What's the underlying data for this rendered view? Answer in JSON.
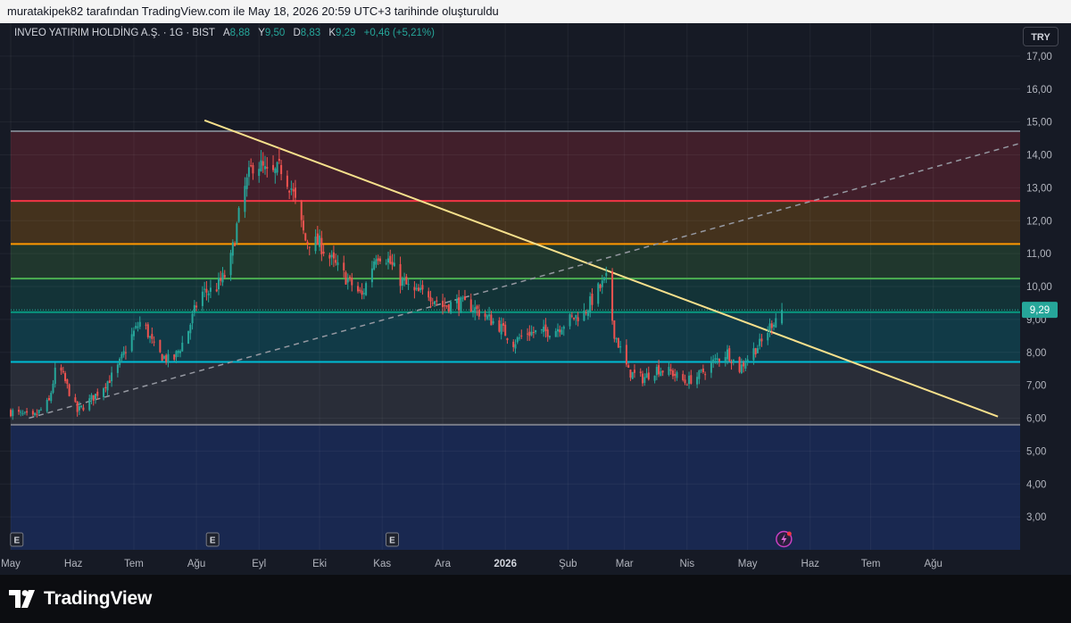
{
  "header": {
    "attribution": "muratakipek82 tarafından TradingView.com ile May 18, 2026 20:59 UTC+3 tarihinde oluşturuldu"
  },
  "legend": {
    "symbol": "INVEO YATIRIM HOLDİNG A.Ş. · 1G · BIST",
    "open_label": "A",
    "open_value": "8,88",
    "high_label": "Y",
    "high_value": "9,50",
    "low_label": "D",
    "low_value": "8,83",
    "close_label": "K",
    "close_value": "9,29",
    "change": "+0,46 (+5,21%)"
  },
  "currency_button": "TRY",
  "footer": {
    "brand": "TradingView"
  },
  "colors": {
    "up": "#26a69a",
    "down": "#ef5350",
    "trendline": "#f7e08c",
    "dashed_trendline": "#9598a1",
    "price_line": "#26a69a"
  },
  "chart_data": {
    "type": "candlestick",
    "title": "INVEO YATIRIM HOLDİNG A.Ş. · 1G · BIST",
    "x_range": [
      "2025-05-01",
      "2026-09-13"
    ],
    "ylim": [
      2.0,
      18.0
    ],
    "y_ticks": [
      "3,00",
      "4,00",
      "5,00",
      "6,00",
      "7,00",
      "8,00",
      "9,00",
      "10,00",
      "11,00",
      "12,00",
      "13,00",
      "14,00",
      "15,00",
      "16,00",
      "17,00"
    ],
    "x_ticks": [
      {
        "date": "2025-05-01",
        "label": "May",
        "bold": false
      },
      {
        "date": "2025-06-01",
        "label": "Haz",
        "bold": false
      },
      {
        "date": "2025-07-01",
        "label": "Tem",
        "bold": false
      },
      {
        "date": "2025-08-01",
        "label": "Ağu",
        "bold": false
      },
      {
        "date": "2025-09-01",
        "label": "Eyl",
        "bold": false
      },
      {
        "date": "2025-10-01",
        "label": "Eki",
        "bold": false
      },
      {
        "date": "2025-11-01",
        "label": "Kas",
        "bold": false
      },
      {
        "date": "2025-12-01",
        "label": "Ara",
        "bold": false
      },
      {
        "date": "2026-01-01",
        "label": "2026",
        "bold": true
      },
      {
        "date": "2026-02-01",
        "label": "Şub",
        "bold": false
      },
      {
        "date": "2026-03-01",
        "label": "Mar",
        "bold": false
      },
      {
        "date": "2026-04-01",
        "label": "Nis",
        "bold": false
      },
      {
        "date": "2026-05-01",
        "label": "May",
        "bold": false
      },
      {
        "date": "2026-06-01",
        "label": "Haz",
        "bold": false
      },
      {
        "date": "2026-07-01",
        "label": "Tem",
        "bold": false
      },
      {
        "date": "2026-08-01",
        "label": "Ağu",
        "bold": false
      }
    ],
    "last_price": 9.29,
    "last_price_label": "9,29",
    "price_path": [
      [
        "2025-05-01",
        6.2
      ],
      [
        "2025-05-12",
        6.0
      ],
      [
        "2025-05-20",
        6.5
      ],
      [
        "2025-05-24",
        7.7
      ],
      [
        "2025-06-03",
        6.2
      ],
      [
        "2025-06-12",
        6.7
      ],
      [
        "2025-06-22",
        7.4
      ],
      [
        "2025-06-30",
        8.5
      ],
      [
        "2025-07-05",
        9.0
      ],
      [
        "2025-07-12",
        8.0
      ],
      [
        "2025-07-20",
        7.7
      ],
      [
        "2025-07-27",
        8.5
      ],
      [
        "2025-08-03",
        9.8
      ],
      [
        "2025-08-10",
        9.9
      ],
      [
        "2025-08-17",
        10.5
      ],
      [
        "2025-08-24",
        12.8
      ],
      [
        "2025-08-30",
        13.9
      ],
      [
        "2025-09-06",
        13.3
      ],
      [
        "2025-09-12",
        13.6
      ],
      [
        "2025-09-17",
        13.0
      ],
      [
        "2025-09-24",
        11.4
      ],
      [
        "2025-10-01",
        11.3
      ],
      [
        "2025-10-08",
        10.7
      ],
      [
        "2025-10-15",
        10.2
      ],
      [
        "2025-10-22",
        9.7
      ],
      [
        "2025-10-29",
        11.0
      ],
      [
        "2025-11-03",
        10.9
      ],
      [
        "2025-11-10",
        10.2
      ],
      [
        "2025-11-17",
        9.8
      ],
      [
        "2025-11-24",
        9.8
      ],
      [
        "2025-12-01",
        9.4
      ],
      [
        "2025-12-08",
        9.5
      ],
      [
        "2025-12-15",
        9.4
      ],
      [
        "2025-12-22",
        9.1
      ],
      [
        "2025-12-29",
        8.8
      ],
      [
        "2026-01-05",
        8.3
      ],
      [
        "2026-01-12",
        8.6
      ],
      [
        "2026-01-19",
        8.6
      ],
      [
        "2026-01-26",
        8.7
      ],
      [
        "2026-02-02",
        9.0
      ],
      [
        "2026-02-09",
        9.2
      ],
      [
        "2026-02-16",
        9.9
      ],
      [
        "2026-02-20",
        10.2
      ],
      [
        "2026-02-24",
        8.6
      ],
      [
        "2026-03-03",
        7.4
      ],
      [
        "2026-03-10",
        7.2
      ],
      [
        "2026-03-17",
        7.5
      ],
      [
        "2026-03-24",
        7.4
      ],
      [
        "2026-03-31",
        7.1
      ],
      [
        "2026-04-07",
        7.3
      ],
      [
        "2026-04-14",
        7.7
      ],
      [
        "2026-04-21",
        8.0
      ],
      [
        "2026-04-27",
        7.5
      ],
      [
        "2026-05-03",
        8.0
      ],
      [
        "2026-05-08",
        8.3
      ],
      [
        "2026-05-13",
        8.9
      ],
      [
        "2026-05-18",
        9.29
      ]
    ],
    "fib_levels": [
      {
        "value": 14.72,
        "color": "#787b86"
      },
      {
        "value": 12.6,
        "color": "#f23645"
      },
      {
        "value": 11.29,
        "color": "#ff9800"
      },
      {
        "value": 10.24,
        "color": "#4caf50"
      },
      {
        "value": 9.22,
        "color": "#089981"
      },
      {
        "value": 7.71,
        "color": "#00bcd4"
      },
      {
        "value": 5.8,
        "color": "#787b86"
      }
    ],
    "fib_bands": [
      {
        "from": 14.72,
        "to": 12.6,
        "color": "#f23645"
      },
      {
        "from": 12.6,
        "to": 11.29,
        "color": "#ff9800"
      },
      {
        "from": 11.29,
        "to": 10.24,
        "color": "#4caf50"
      },
      {
        "from": 10.24,
        "to": 9.22,
        "color": "#089981"
      },
      {
        "from": 9.22,
        "to": 7.71,
        "color": "#00bcd4"
      },
      {
        "from": 7.71,
        "to": 5.8,
        "color": "#787b86"
      },
      {
        "from": 5.8,
        "to": 2.0,
        "color": "#2962ff"
      }
    ],
    "trendlines": [
      {
        "style": "solid",
        "points": [
          [
            "2025-08-05",
            15.05
          ],
          [
            "2026-09-02",
            6.05
          ]
        ]
      },
      {
        "style": "dashed",
        "points": [
          [
            "2025-05-10",
            6.0
          ],
          [
            "2026-09-13",
            14.35
          ]
        ]
      }
    ],
    "earnings_markers": [
      {
        "date": "2025-05-04",
        "label": "E"
      },
      {
        "date": "2025-08-09",
        "label": "E"
      },
      {
        "date": "2025-11-06",
        "label": "E"
      }
    ],
    "event_marker": {
      "date": "2026-05-19",
      "icon": "lightning-icon"
    }
  }
}
